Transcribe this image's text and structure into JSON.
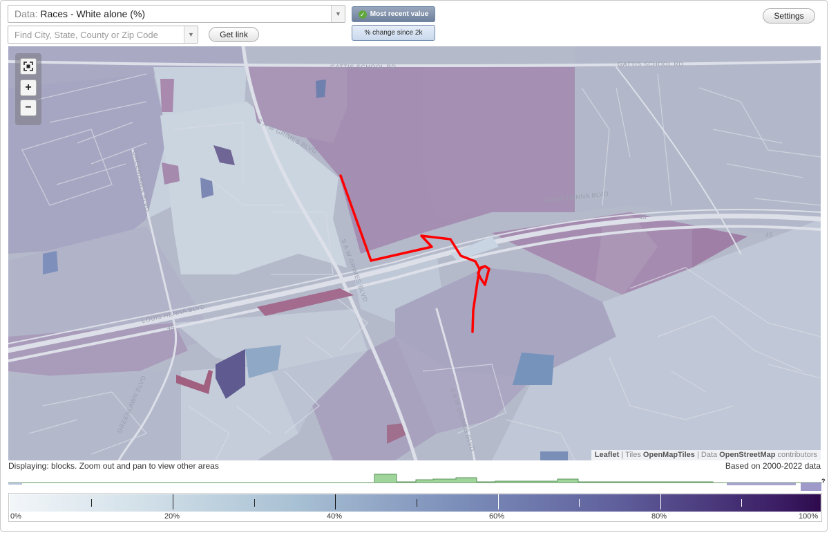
{
  "header": {
    "data_prefix": "Data:",
    "data_value": "Races - White alone (%)",
    "search_placeholder": "Find City, State, County or Zip Code",
    "get_link_label": "Get link",
    "most_recent_label": "Most recent value",
    "pct_change_label": "% change since 2k",
    "settings_label": "Settings"
  },
  "map": {
    "zoom_controls": {
      "fit": "fit-bounds",
      "zoom_in": "+",
      "zoom_out": "−"
    },
    "street_labels": {
      "gattis_1": "GATTIS SCHOOL RD",
      "gattis_2": "GATTIS SCHOOL RD",
      "grimes_n": "S A W GRIMES BLVD",
      "grimes_mid": "S A W GRIMES BLVD",
      "grimes_s": "S A W GRIMES BLVD",
      "louis_henna_e": "LOUIS HENNA BLVD",
      "louis_henna_w": "LOUIS HENNA BLVD",
      "greenlawn_n": "GREENLAWN BLVD",
      "greenlawn_s": "GREENLAWN BLVD",
      "route_45_a": "45",
      "route_45_b": "45",
      "route_45_c": "45"
    },
    "attribution": {
      "leaflet": "Leaflet",
      "sep1": " | Tiles ",
      "tiles": "OpenMapTiles",
      "sep2": " | Data ",
      "data": "OpenStreetMap",
      "contributors": " contributors"
    },
    "boundary_color": "#ff0000"
  },
  "footer": {
    "displaying": "Displaying: blocks. Zoom out and pan to view other areas",
    "based_on": "Based on 2000-2022 data",
    "histogram_unknown": "?"
  },
  "legend": {
    "labels": [
      "0%",
      "20%",
      "40%",
      "60%",
      "80%",
      "100%"
    ],
    "gradient_start": "#f2f6f9",
    "gradient_end": "#2d0a4c"
  }
}
